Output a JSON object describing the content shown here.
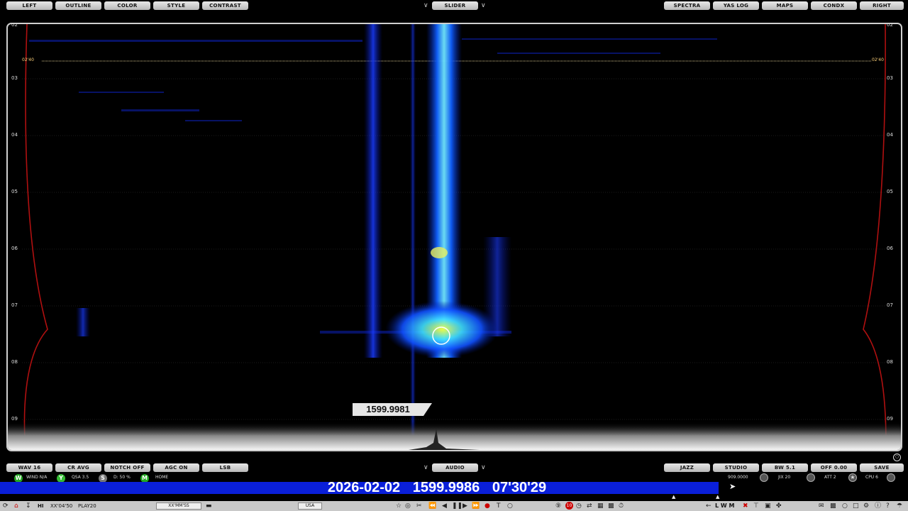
{
  "top_buttons_left": [
    "LEFT",
    "OUTLINE",
    "COLOR",
    "STYLE",
    "CONTRAST"
  ],
  "top_center": "SLIDER",
  "top_buttons_right": [
    "SPECTRA",
    "YAS LOG",
    "MAPS",
    "CONDX",
    "RIGHT"
  ],
  "time_ticks": [
    "02",
    "03",
    "04",
    "05",
    "06",
    "07",
    "08",
    "09"
  ],
  "marker_time": "02'40",
  "peak_frequency": "1599.9981",
  "bottom_buttons_left": [
    "WAV 16",
    "CR AVG",
    "NOTCH OFF",
    "AGC ON",
    "LSB"
  ],
  "bottom_center": "AUDIO",
  "bottom_buttons_right": [
    "JAZZ",
    "STUDIO",
    "BW 5.1",
    "OFF 0.00",
    "SAVE"
  ],
  "status": {
    "wind": "WIND N/A",
    "qsa": "QSA 3.5",
    "d": "D: 50 %",
    "home": "HOME",
    "tune_freq": "909.0000",
    "jix": "JIX 20",
    "att": "ATT 2",
    "cpu": "CPU 6"
  },
  "status_dots": [
    {
      "letter": "W",
      "color": "#22aa22"
    },
    {
      "letter": "Y",
      "color": "#33bb33"
    },
    {
      "letter": "S",
      "color": "#777777"
    },
    {
      "letter": "M",
      "color": "#22aa22"
    }
  ],
  "big_readout": {
    "date": "2026-02-02",
    "frequency": "1599.9986",
    "time": "07'30'29"
  },
  "bottom_bar": {
    "hi": "HI",
    "position": "XX'04'50",
    "play": "PLAY20",
    "format": "XX'MM'SS",
    "country": "USA",
    "rec_count": "10",
    "letters": "L W M"
  },
  "colors": {
    "accent_blue": "#0a1fd9",
    "button_gray": "#d0d0d0",
    "envelope_red": "#b01010"
  }
}
